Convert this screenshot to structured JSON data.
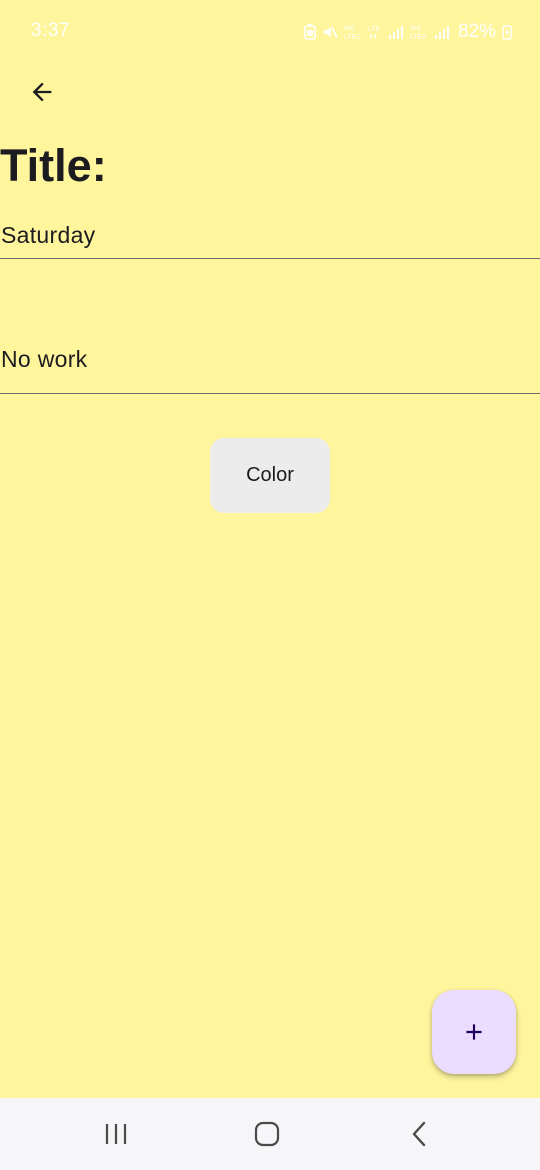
{
  "status_bar": {
    "time": "3:37",
    "battery_percent": "82%",
    "icons": [
      "battery-saver-icon",
      "mute-icon",
      "volte-icon",
      "lte-icon",
      "signal-icon",
      "volte2-icon",
      "signal2-icon",
      "charging-icon"
    ]
  },
  "header": {
    "back_icon": "arrow-left-icon"
  },
  "editor": {
    "title_label": "Title:",
    "title_value": "Saturday",
    "body_value": "No work"
  },
  "color_button": {
    "label": "Color"
  },
  "fab": {
    "icon": "plus-icon"
  },
  "navigation": {
    "recents_icon": "recents-icon",
    "home_icon": "home-icon",
    "back_icon": "nav-back-icon"
  },
  "colors": {
    "background": "#FFF59D",
    "color_button": "#ECECEC",
    "fab": "#EADDFF",
    "fab_icon": "#21005D",
    "nav_bar": "#F6F5F8"
  }
}
